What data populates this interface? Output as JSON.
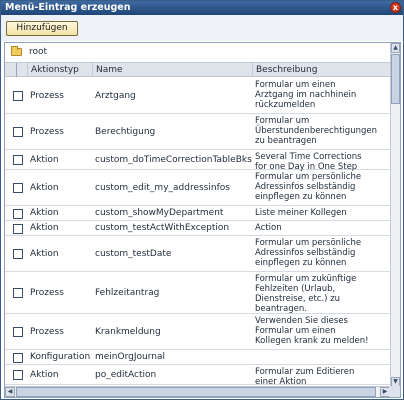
{
  "window": {
    "title": "Menü-Eintrag erzeugen",
    "close_glyph": "x"
  },
  "toolbar": {
    "add_label": "Hinzufügen"
  },
  "tree": {
    "root_label": "root"
  },
  "table": {
    "columns": [
      "Aktionstyp",
      "Name",
      "Beschreibung"
    ],
    "rows": [
      {
        "type": "Prozess",
        "name": "Arztgang",
        "desc": "Formular um einen\nArztgang im nachhinein\nrückzumelden"
      },
      {
        "type": "Prozess",
        "name": "Berechtigung",
        "desc": "Formular um\nÜberstundenberechtigungen\nzu beantragen"
      },
      {
        "type": "Aktion",
        "name": "custom_doTimeCorrectionTableBks",
        "desc": "Several Time Corrections\nfor one Day in One Step"
      },
      {
        "type": "Aktion",
        "name": "custom_edit_my_addressinfos",
        "desc": "Formular um persönliche\nAdressinfos selbständig\neinpflegen zu können"
      },
      {
        "type": "Aktion",
        "name": "custom_showMyDepartment",
        "desc": "Liste meiner Kollegen"
      },
      {
        "type": "Aktion",
        "name": "custom_testActWithException",
        "desc": "Action"
      },
      {
        "type": "Aktion",
        "name": "custom_testDate",
        "desc": "Formular um persönliche\nAdressinfos selbständig\neinpflegen zu können"
      },
      {
        "type": "Prozess",
        "name": "Fehlzeitantrag",
        "desc": "Formular um zukünftige\nFehlzeiten (Urlaub,\nDienstreise, etc.) zu\nbeantragen."
      },
      {
        "type": "Prozess",
        "name": "Krankmeldung",
        "desc": "Verwenden Sie dieses\nFormular um einen\nKollegen krank zu melden!"
      },
      {
        "type": "Konfiguration",
        "name": "meinOrgJournal",
        "desc": ""
      },
      {
        "type": "Aktion",
        "name": "po_editAction",
        "desc": "Formular zum Editieren\neiner Aktion"
      }
    ]
  },
  "colors": {
    "title_bar": "#1f4577",
    "header_bg": "#dfe3ea",
    "button_bg": "#f1e2a6"
  }
}
